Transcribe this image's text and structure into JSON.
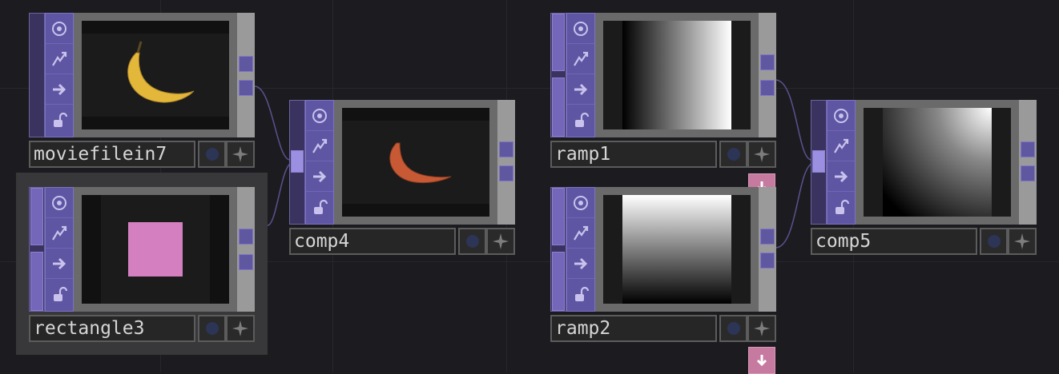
{
  "colors": {
    "background": "#1c1c20",
    "flag_panel": "#5e55a3",
    "connector": "#7466b8",
    "wire": "#5a5290",
    "export_tag": "#c77a9f",
    "rectangle_fill": "#d47fbf",
    "banana_yellow": "#e3b73a",
    "banana_red": "#c75a35"
  },
  "flag_icons": [
    "viewer-icon",
    "cook-icon",
    "arrow-right-icon",
    "lock-icon"
  ],
  "nodes": {
    "moviefilein7": {
      "name": "moviefilein7",
      "viewer_content": "banana-image",
      "selected": false
    },
    "rectangle3": {
      "name": "rectangle3",
      "viewer_content": "pink-rectangle",
      "selected": true
    },
    "comp4": {
      "name": "comp4",
      "viewer_content": "red-banana-image",
      "selected": false
    },
    "ramp1": {
      "name": "ramp1",
      "viewer_content": "horizontal-ramp",
      "selected": false
    },
    "ramp2": {
      "name": "ramp2",
      "viewer_content": "vertical-ramp",
      "selected": false
    },
    "comp5": {
      "name": "comp5",
      "viewer_content": "diagonal-ramp",
      "selected": false
    }
  },
  "connections": [
    {
      "from": "moviefilein7",
      "to": "comp4"
    },
    {
      "from": "rectangle3",
      "to": "comp4"
    },
    {
      "from": "ramp1",
      "to": "comp5"
    },
    {
      "from": "ramp2",
      "to": "comp5"
    }
  ]
}
